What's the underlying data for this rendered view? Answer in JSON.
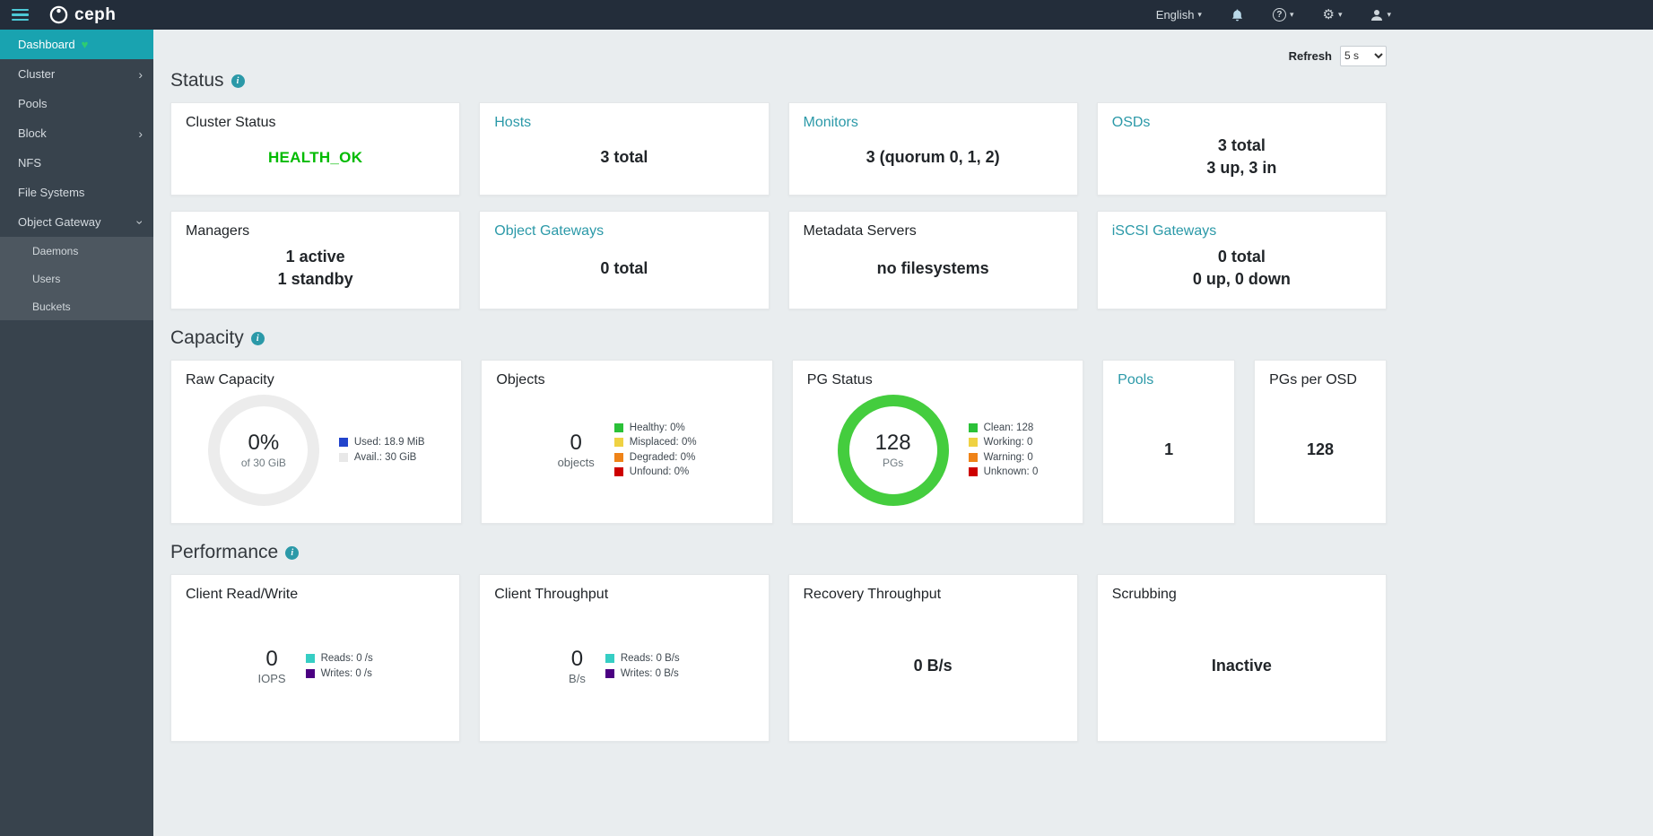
{
  "navbar": {
    "brand": "ceph",
    "language": "English"
  },
  "sidebar": {
    "items": [
      {
        "label": "Dashboard"
      },
      {
        "label": "Cluster"
      },
      {
        "label": "Pools"
      },
      {
        "label": "Block"
      },
      {
        "label": "NFS"
      },
      {
        "label": "File Systems"
      },
      {
        "label": "Object Gateway"
      },
      {
        "label": "Daemons"
      },
      {
        "label": "Users"
      },
      {
        "label": "Buckets"
      }
    ]
  },
  "refresh": {
    "label": "Refresh",
    "value": "5 s"
  },
  "status": {
    "heading": "Status",
    "cluster_status": {
      "title": "Cluster Status",
      "value": "HEALTH_OK"
    },
    "hosts": {
      "title": "Hosts",
      "value": "3 total"
    },
    "monitors": {
      "title": "Monitors",
      "value": "3 (quorum 0, 1, 2)"
    },
    "osds": {
      "title": "OSDs",
      "line1": "3 total",
      "line2": "3 up, 3 in"
    },
    "managers": {
      "title": "Managers",
      "line1": "1 active",
      "line2": "1 standby"
    },
    "object_gateways": {
      "title": "Object Gateways",
      "value": "0 total"
    },
    "metadata_servers": {
      "title": "Metadata Servers",
      "value": "no filesystems"
    },
    "iscsi_gateways": {
      "title": "iSCSI Gateways",
      "line1": "0 total",
      "line2": "0 up, 0 down"
    }
  },
  "capacity": {
    "heading": "Capacity",
    "raw_capacity": {
      "title": "Raw Capacity",
      "center_value": "0%",
      "center_sub": "of 30 GiB",
      "legend": [
        {
          "label": "Used: 18.9 MiB",
          "color": "#2244cc"
        },
        {
          "label": "Avail.: 30 GiB",
          "color": "#e8e8e8"
        }
      ]
    },
    "objects": {
      "title": "Objects",
      "center_value": "0",
      "center_sub": "objects",
      "legend": [
        {
          "label": "Healthy: 0%",
          "color": "#2bc138"
        },
        {
          "label": "Misplaced: 0%",
          "color": "#efd243"
        },
        {
          "label": "Degraded: 0%",
          "color": "#ef8318"
        },
        {
          "label": "Unfound: 0%",
          "color": "#cd0000"
        }
      ]
    },
    "pg_status": {
      "title": "PG Status",
      "center_value": "128",
      "center_sub": "PGs",
      "legend": [
        {
          "label": "Clean: 128",
          "color": "#2bc138"
        },
        {
          "label": "Working: 0",
          "color": "#efd243"
        },
        {
          "label": "Warning: 0",
          "color": "#ef8318"
        },
        {
          "label": "Unknown: 0",
          "color": "#cd0000"
        }
      ]
    },
    "pools": {
      "title": "Pools",
      "value": "1"
    },
    "pgs_per_osd": {
      "title": "PGs per OSD",
      "value": "128"
    }
  },
  "performance": {
    "heading": "Performance",
    "client_read_write": {
      "title": "Client Read/Write",
      "center_value": "0",
      "center_sub": "IOPS",
      "legend": [
        {
          "label": "Reads: 0 /s",
          "color": "#36cec4"
        },
        {
          "label": "Writes: 0 /s",
          "color": "#4b0082"
        }
      ]
    },
    "client_throughput": {
      "title": "Client Throughput",
      "center_value": "0",
      "center_sub": "B/s",
      "legend": [
        {
          "label": "Reads: 0 B/s",
          "color": "#36cec4"
        },
        {
          "label": "Writes: 0 B/s",
          "color": "#4b0082"
        }
      ]
    },
    "recovery_throughput": {
      "title": "Recovery Throughput",
      "value": "0 B/s"
    },
    "scrubbing": {
      "title": "Scrubbing",
      "value": "Inactive"
    }
  },
  "colors": {
    "navbar_bg": "#232d3a",
    "sidebar_bg": "#38434d",
    "active_nav_teal": "#19a3b0",
    "accent_teal": "#2b99a8",
    "health_ok_green": "#00bb00",
    "pg_donut_green": "#44cd3e",
    "heart_green": "#2ecc71"
  }
}
